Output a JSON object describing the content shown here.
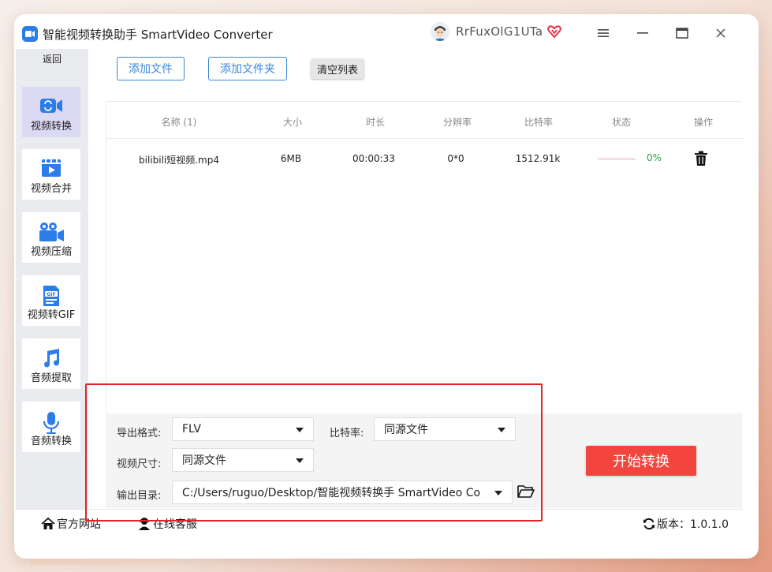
{
  "app": {
    "title": "智能视频转换助手 SmartVideo Converter",
    "username": "RrFuxOlG1UTa"
  },
  "sidebar": {
    "back_label": "返回",
    "items": [
      {
        "label": "视频转换",
        "icon": "video-convert-icon",
        "active": true
      },
      {
        "label": "视频合并",
        "icon": "video-merge-icon",
        "active": false
      },
      {
        "label": "视频压缩",
        "icon": "video-compress-icon",
        "active": false
      },
      {
        "label": "视频转GIF",
        "icon": "gif-icon",
        "active": false
      },
      {
        "label": "音频提取",
        "icon": "music-note-icon",
        "active": false
      },
      {
        "label": "音频转换",
        "icon": "microphone-icon",
        "active": false
      }
    ]
  },
  "toolbar": {
    "add_file": "添加文件",
    "add_folder": "添加文件夹",
    "clear_list": "清空列表"
  },
  "table": {
    "headers": {
      "name": "名称 (1)",
      "size": "大小",
      "duration": "时长",
      "resolution": "分辨率",
      "bitrate": "比特率",
      "status": "状态",
      "action": "操作"
    },
    "rows": [
      {
        "name": "bilibili短视频.mp4",
        "size": "6MB",
        "duration": "00:00:33",
        "resolution": "0*0",
        "bitrate": "1512.91k",
        "progress_text": "0%",
        "progress": 0
      }
    ]
  },
  "settings": {
    "format_label": "导出格式:",
    "format_value": "FLV",
    "bitrate_label": "比特率:",
    "bitrate_value": "同源文件",
    "size_label": "视频尺寸:",
    "size_value": "同源文件",
    "output_label": "输出目录:",
    "output_value": "C:/Users/ruguo/Desktop/智能视频转换手 SmartVideo Co",
    "start_button": "开始转换"
  },
  "footer": {
    "website": "官方网站",
    "support": "在线客服",
    "version": "版本：1.0.1.0"
  },
  "colors": {
    "accent_blue": "#3a86d8",
    "start_red": "#f2453d",
    "highlight_red": "#e02424",
    "active_nav": "#dcd9f4",
    "progress_green": "#2ea043"
  }
}
